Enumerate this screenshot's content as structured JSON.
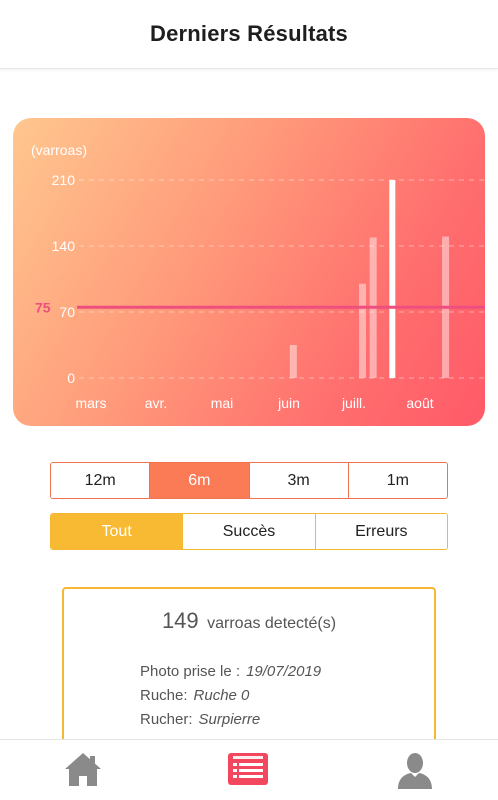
{
  "header": {
    "title": "Derniers Résultats"
  },
  "chart_data": {
    "type": "bar",
    "ylabel": "(varroas)",
    "y_ticks": [
      "210",
      "140",
      "70",
      "0"
    ],
    "ylim": [
      0,
      210
    ],
    "x_ticks": [
      "mars",
      "avr.",
      "mai",
      "juin",
      "juill.",
      "août"
    ],
    "threshold": {
      "label": "75",
      "value": 75,
      "color": "#ee4f7e"
    },
    "bars": [
      {
        "date": "2019-06-03",
        "value": 35
      },
      {
        "date": "2019-07-05",
        "value": 100
      },
      {
        "date": "2019-07-10",
        "value": 149
      },
      {
        "date": "2019-07-19",
        "value": 210,
        "selected": true
      },
      {
        "date": "2019-08-13",
        "value": 150
      }
    ],
    "grid": "dashed horizontal",
    "colors": {
      "bar": "#ffffff",
      "gradient_start": "#ffc78f",
      "gradient_end": "#ff5a68"
    }
  },
  "period": {
    "options": [
      "12m",
      "6m",
      "3m",
      "1m"
    ],
    "selected": "6m"
  },
  "filter": {
    "options": [
      "Tout",
      "Succès",
      "Erreurs"
    ],
    "selected": "Tout"
  },
  "result": {
    "count": "149",
    "count_label": "varroas detecté(s)",
    "photo_label": "Photo prise le :",
    "photo_date": "19/07/2019",
    "hive_label": "Ruche:",
    "hive_value": "Ruche 0",
    "apiary_label": "Rucher:",
    "apiary_value": "Surpierre"
  },
  "nav": {
    "icons": [
      "home-icon",
      "list-icon",
      "user-icon"
    ],
    "active": "list-icon",
    "active_color": "#f2475f",
    "inactive_color": "#8a8a8a"
  }
}
